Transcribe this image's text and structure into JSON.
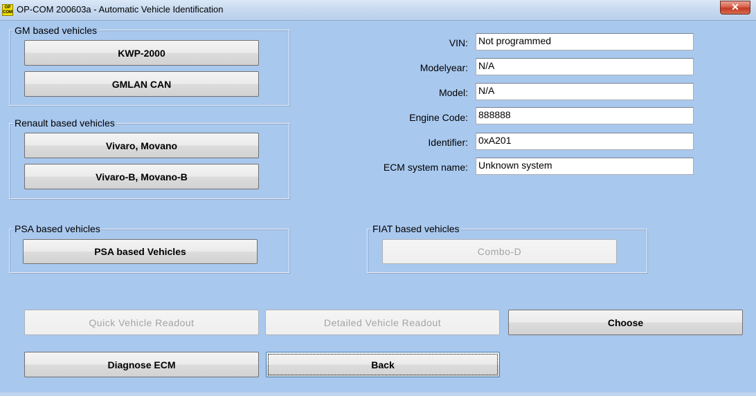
{
  "window": {
    "icon_text": "OP COM",
    "title": "OP-COM 200603a - Automatic Vehicle Identification",
    "close_glyph": "✕"
  },
  "groups": {
    "gm": {
      "label": "GM based vehicles",
      "buttons": [
        "KWP-2000",
        "GMLAN CAN"
      ]
    },
    "renault": {
      "label": "Renault based vehicles",
      "buttons": [
        "Vivaro, Movano",
        "Vivaro-B, Movano-B"
      ]
    },
    "psa": {
      "label": "PSA based vehicles",
      "buttons": [
        "PSA based Vehicles"
      ]
    },
    "fiat": {
      "label": "FIAT based vehicles",
      "buttons": [
        "Combo-D"
      ]
    }
  },
  "info": {
    "vin_label": "VIN:",
    "vin_value": "Not programmed",
    "modelyear_label": "Modelyear:",
    "modelyear_value": "N/A",
    "model_label": "Model:",
    "model_value": "N/A",
    "engine_label": "Engine Code:",
    "engine_value": "888888",
    "identifier_label": "Identifier:",
    "identifier_value": "0xA201",
    "ecm_label": "ECM system name:",
    "ecm_value": "Unknown system"
  },
  "actions": {
    "quick_readout": "Quick Vehicle Readout",
    "detailed_readout": "Detailed Vehicle Readout",
    "choose": "Choose",
    "diagnose": "Diagnose ECM",
    "back": "Back"
  }
}
